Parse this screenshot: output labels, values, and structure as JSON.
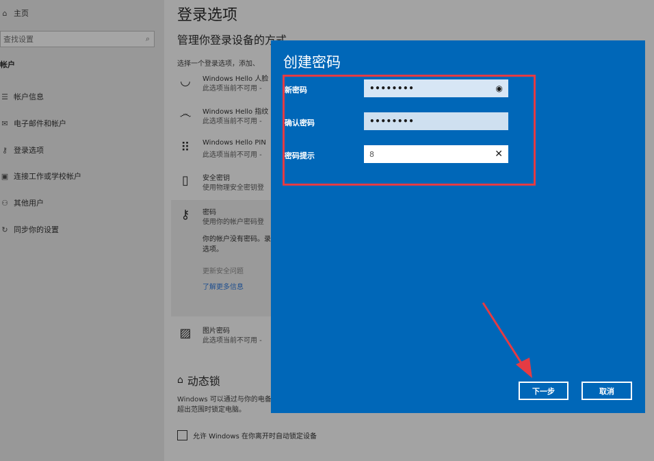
{
  "sidebar": {
    "home": "主页",
    "search_placeholder": "查找设置",
    "section": "帐户",
    "items": [
      {
        "label": "帐户信息",
        "icon": "list-icon"
      },
      {
        "label": "电子邮件和帐户",
        "icon": "mail-icon"
      },
      {
        "label": "登录选项",
        "icon": "key-icon"
      },
      {
        "label": "连接工作或学校帐户",
        "icon": "briefcase-icon"
      },
      {
        "label": "其他用户",
        "icon": "person-add-icon"
      },
      {
        "label": "同步你的设置",
        "icon": "sync-icon"
      }
    ]
  },
  "main": {
    "title": "登录选项",
    "subtitle": "管理你登录设备的方式",
    "desc": "选择一个登录选项，添加、",
    "options": [
      {
        "title": "Windows Hello 人脸",
        "sub": "此选项当前不可用 -"
      },
      {
        "title": "Windows Hello 指纹",
        "sub": "此选项当前不可用 -"
      },
      {
        "title": "Windows Hello PIN",
        "sub": "此选项当前不可用 -"
      },
      {
        "title": "安全密钥",
        "sub": "使用物理安全密钥登"
      },
      {
        "title": "密码",
        "sub": "使用你的帐户密码登"
      },
      {
        "title": "图片密码",
        "sub": "此选项当前不可用 -"
      }
    ],
    "pw_message": "你的帐户没有密码。录选项。",
    "security_questions": "更新安全问题",
    "learn_more": "了解更多信息",
    "dynamic_lock_title": "动态锁",
    "dynamic_lock_desc": "Windows 可以通过与你的电备超出范围时锁定电脑。",
    "allow_label": "允许 Windows 在你离开时自动锁定设备"
  },
  "dialog": {
    "title": "创建密码",
    "fields": [
      {
        "label": "新密码",
        "value": "••••••••",
        "icon": "eye-icon"
      },
      {
        "label": "确认密码",
        "value": "••••••••"
      },
      {
        "label": "密码提示",
        "value": "8",
        "icon": "clear-icon"
      }
    ],
    "next": "下一步",
    "cancel": "取消"
  },
  "colors": {
    "dialog_bg": "#0067b8",
    "highlight": "#e53b43"
  }
}
